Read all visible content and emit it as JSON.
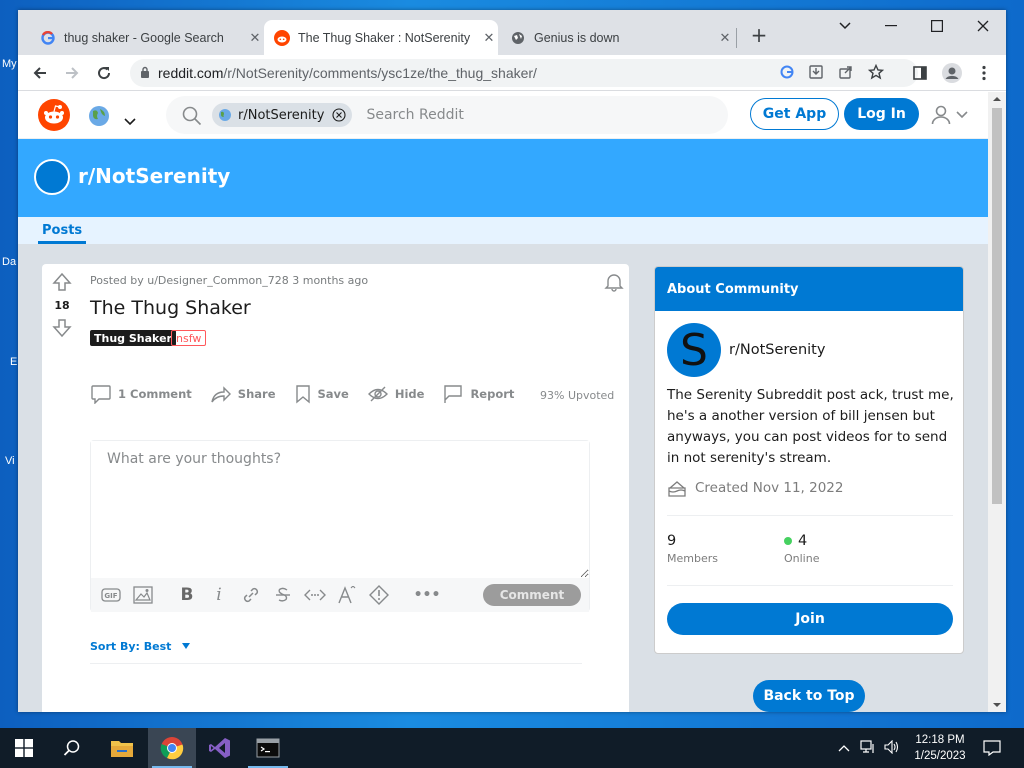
{
  "browser": {
    "tabs": [
      {
        "title": "thug shaker - Google Search",
        "close": "✕"
      },
      {
        "title": "The Thug Shaker : NotSerenity",
        "close": "✕"
      },
      {
        "title": "Genius is down",
        "close": "✕"
      }
    ],
    "new_tab": "+",
    "url_host": "reddit.com",
    "url_path": "/r/NotSerenity/comments/ysc1ze/the_thug_shaker/"
  },
  "desktop": {
    "labels": [
      "My",
      "Da",
      "E",
      "Vi"
    ]
  },
  "reddit": {
    "community_chip": "r/NotSerenity",
    "search_placeholder": "Search Reddit",
    "get_app": "Get App",
    "log_in": "Log In",
    "banner_title": "r/NotSerenity",
    "posts_tab": "Posts"
  },
  "post": {
    "votes": "18",
    "meta": "Posted by u/Designer_Common_728 3 months ago",
    "title": "The Thug Shaker",
    "flair": "Thug Shaker",
    "nsfw": "nsfw",
    "actions": {
      "comments": "1 Comment",
      "share": "Share",
      "save": "Save",
      "hide": "Hide",
      "report": "Report"
    },
    "upvoted": "93% Upvoted",
    "comment_placeholder": "What are your thoughts?",
    "comment_button": "Comment",
    "sort_by": "Sort By: Best"
  },
  "about": {
    "header": "About Community",
    "avatar_letter": "S",
    "name": "r/NotSerenity",
    "description": "The Serenity Subreddit post ack, trust me, he's a another version of bill jensen but anyways, you can post videos for to send in not serenity's stream.",
    "created": "Created Nov 11, 2022",
    "members_count": "9",
    "members_label": "Members",
    "online_count": "4",
    "online_label": "Online",
    "join": "Join"
  },
  "back_to_top": "Back to Top",
  "taskbar": {
    "time": "12:18 PM",
    "date": "1/25/2023"
  },
  "colors": {
    "reddit_blue": "#0079d3",
    "banner": "#33a8ff",
    "online_dot": "#46d160"
  }
}
